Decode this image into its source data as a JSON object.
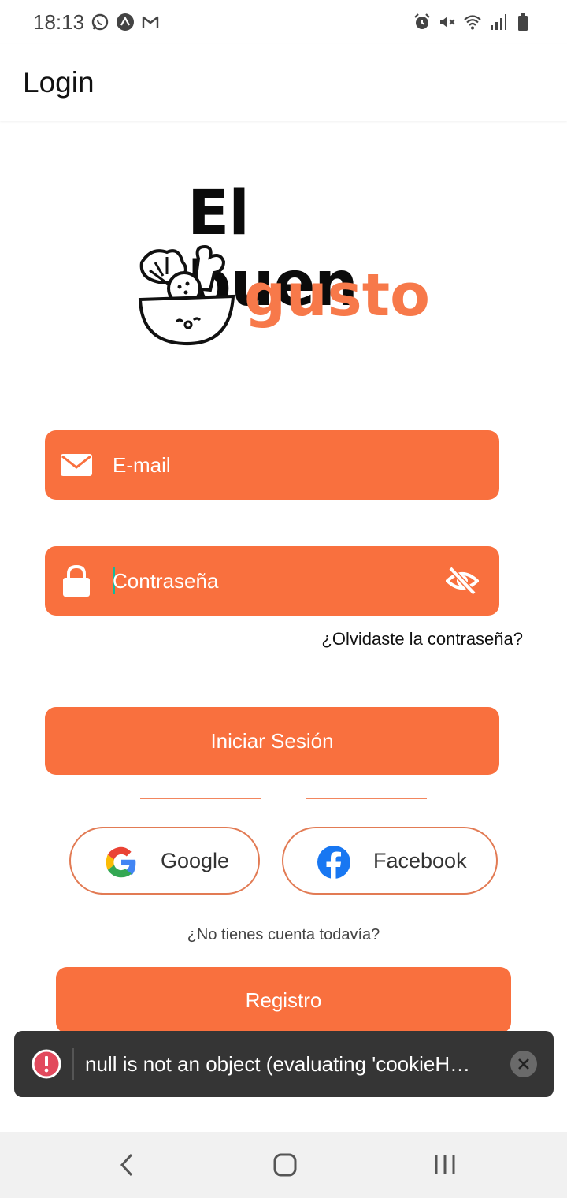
{
  "status_bar": {
    "time": "18:13",
    "left_icons": [
      "whatsapp-icon",
      "expo-icon",
      "gmail-icon"
    ],
    "right_icons": [
      "alarm-icon",
      "mute-icon",
      "wifi-icon",
      "signal-icon",
      "battery-icon"
    ]
  },
  "header": {
    "title": "Login"
  },
  "logo": {
    "line1": "El buen",
    "line2": "gusto"
  },
  "form": {
    "email_placeholder": "E-mail",
    "password_placeholder": "Contraseña",
    "forgot_password": "¿Olvidaste la contraseña?",
    "login_button": "Iniciar Sesión"
  },
  "social": {
    "google": "Google",
    "facebook": "Facebook"
  },
  "register": {
    "prompt": "¿No tienes cuenta todavía?",
    "button": "Registro"
  },
  "toast": {
    "message": "null is not an object (evaluating 'cookieHe…"
  },
  "colors": {
    "accent": "#f9703e",
    "logo_orange": "#f7794a",
    "toast_bg": "#353535"
  }
}
